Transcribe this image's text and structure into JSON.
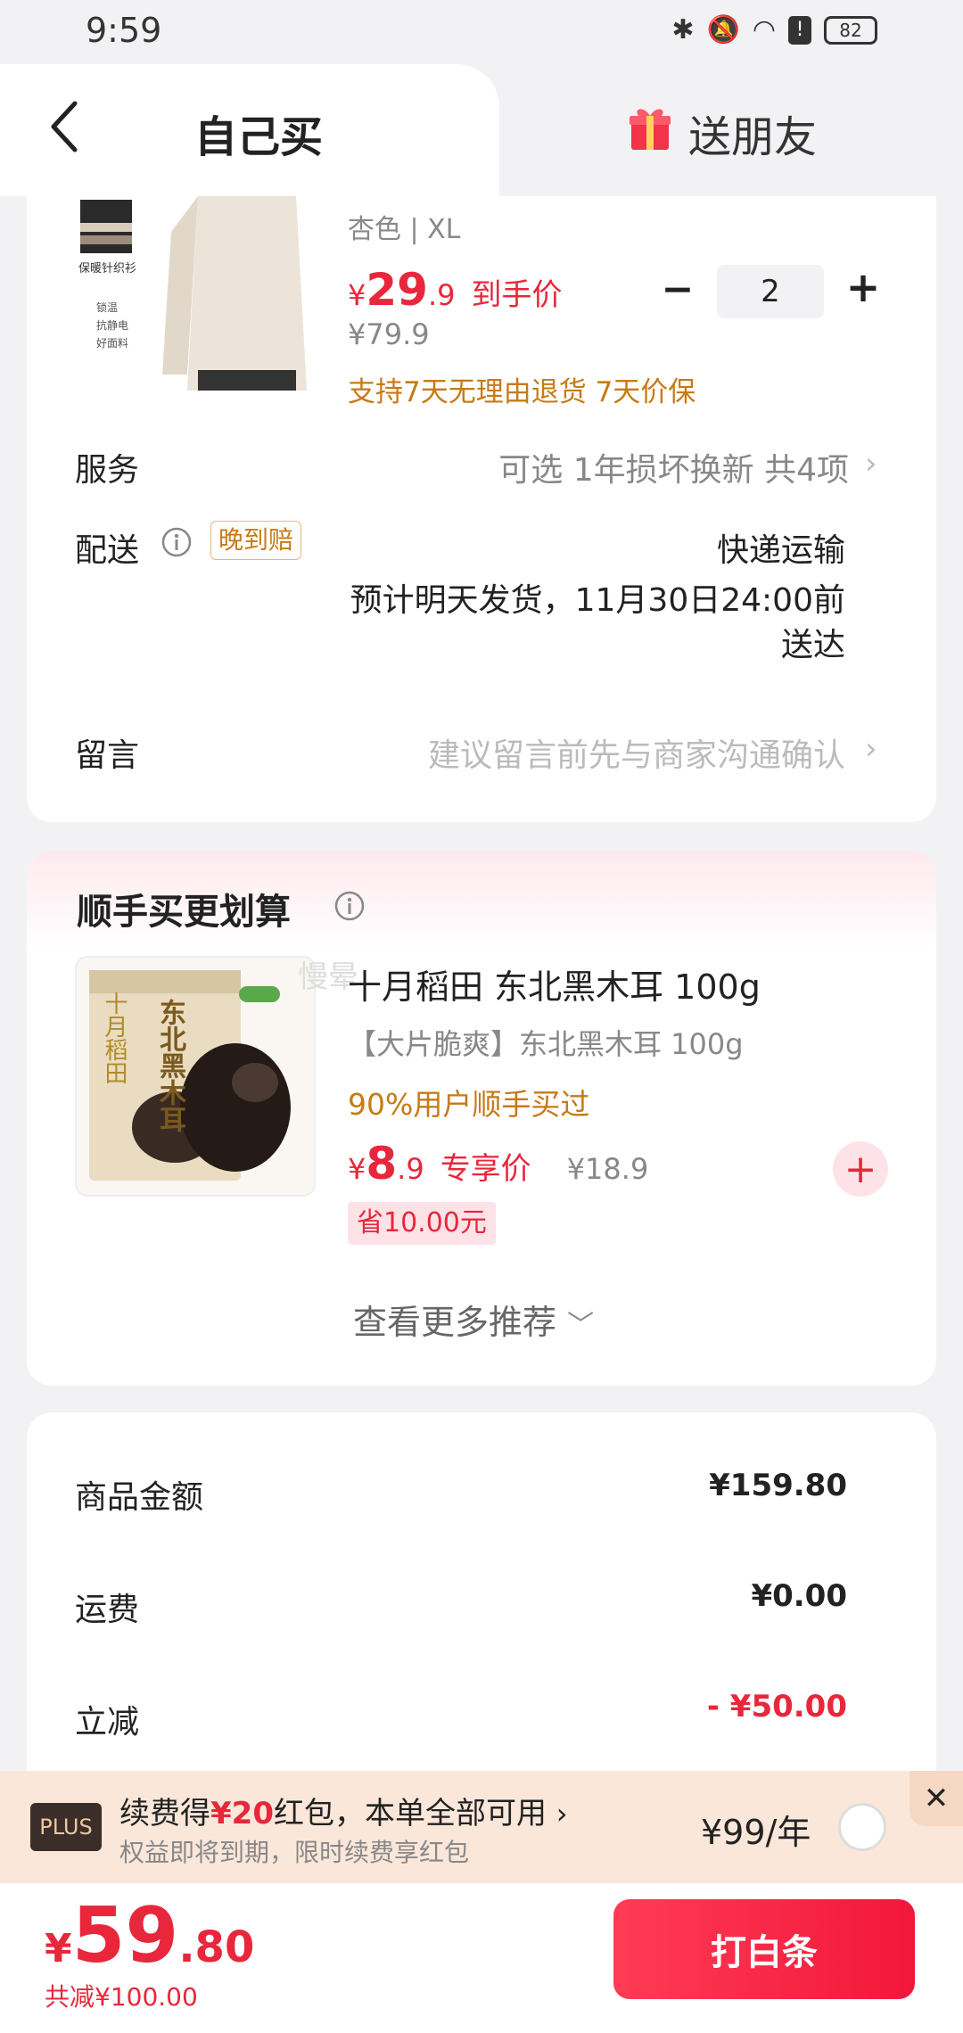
{
  "status_bar": {
    "time": "9:59",
    "battery": "82"
  },
  "tabs": {
    "self_buy": "自己买",
    "gift": "送朋友"
  },
  "product": {
    "thumb_lines": [
      "保暖针织衫",
      "锁温",
      "抗静电",
      "好面料"
    ],
    "spec": "杏色 | XL",
    "currency": "¥",
    "price_int": "29",
    "price_dec": ".9",
    "price_tag": "到手价",
    "original_price": "¥79.9",
    "service_note": "支持7天无理由退货  7天价保",
    "quantity": "2"
  },
  "rows": {
    "service_label": "服务",
    "service_value": "可选 1年损坏换新 共4项",
    "delivery_label": "配送",
    "delivery_badge": "晚到赔",
    "delivery_method": "快递运输",
    "delivery_eta_line1": "预计明天发货，11月30日24:00前",
    "delivery_eta_line2": "送达",
    "note_label": "留言",
    "note_placeholder": "建议留言前先与商家沟通确认"
  },
  "combo": {
    "title": "顺手买更划算",
    "watermark": "慢晕",
    "item_name": "十月稻田 东北黑木耳 100g",
    "item_sub": "【大片脆爽】东北黑木耳 100g",
    "item_note": "90%用户顺手买过",
    "currency": "¥",
    "price_int": "8",
    "price_dec": ".9",
    "price_tag": "专享价",
    "orig_price": "¥18.9",
    "save_tag": "省10.00元",
    "pkg_brand": "十月稻田",
    "pkg_title": "东北黑木耳",
    "more": "查看更多推荐"
  },
  "summary": {
    "goods_label": "商品金额",
    "goods_value": "¥159.80",
    "shipping_label": "运费",
    "shipping_value": "¥0.00",
    "discount_label": "立减",
    "discount_value": "- ¥50.00"
  },
  "plus": {
    "badge": "PLUS",
    "line1_a": "续费得",
    "line1_b": "¥20",
    "line1_c": "红包，本单全部可用",
    "line2": "权益即将到期，限时续费享红包",
    "price": "¥99/年"
  },
  "bottom": {
    "currency": "¥",
    "total_int": "59",
    "total_dec": ".80",
    "total_saved": "共减¥100.00",
    "pay_button": "打白条"
  },
  "colors": {
    "accent_red": "#e8273c",
    "orange_note": "#c77a16"
  }
}
